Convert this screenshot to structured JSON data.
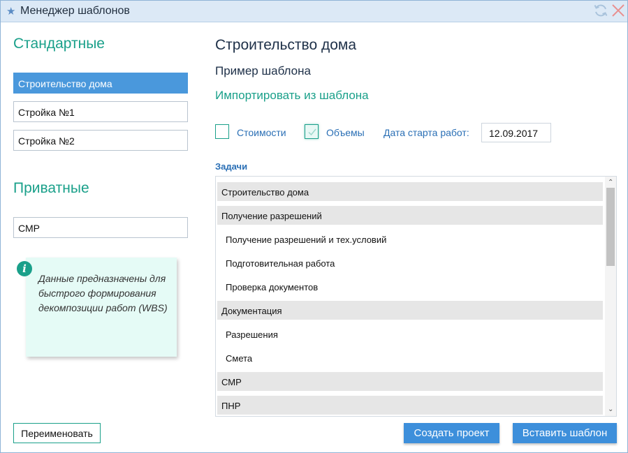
{
  "window": {
    "title": "Менеджер шаблонов"
  },
  "sidebar": {
    "standard_heading": "Стандартные",
    "standard_items": [
      "Строительство дома",
      "Стройка №1",
      "Стройка №2"
    ],
    "private_heading": "Приватные",
    "private_items": [
      "СМР"
    ],
    "info_text": "Данные предназначены для быстрого формирования декомпозиции работ (WBS)",
    "rename_button": "Переименовать"
  },
  "main": {
    "title": "Строительство дома",
    "subtitle": "Пример шаблона",
    "import_link": "Импортировать из шаблона",
    "options": {
      "costs_label": "Стоимости",
      "costs_checked": false,
      "volumes_label": "Объемы",
      "volumes_checked": true,
      "start_date_label": "Дата старта работ:",
      "start_date_value": "12.09.2017"
    },
    "tasks_label": "Задачи",
    "tasks": [
      {
        "label": "Строительство дома",
        "type": "group"
      },
      {
        "label": "Получение разрешений",
        "type": "group"
      },
      {
        "label": "Получение разрешений и тех.условий",
        "type": "child"
      },
      {
        "label": "Подготовительная работа",
        "type": "child"
      },
      {
        "label": "Проверка документов",
        "type": "child"
      },
      {
        "label": "Документация",
        "type": "group"
      },
      {
        "label": "Разрешения",
        "type": "child"
      },
      {
        "label": "Смета",
        "type": "child"
      },
      {
        "label": "СМР",
        "type": "group"
      },
      {
        "label": "ПНР",
        "type": "group"
      }
    ],
    "create_project_button": "Создать проект",
    "insert_template_button": "Вставить шаблон"
  },
  "icons": {
    "star": "star-icon",
    "refresh": "refresh-icon",
    "close": "close-icon",
    "info": "info-icon"
  },
  "colors": {
    "accent_teal": "#1aa08a",
    "selected_blue": "#4a98dc",
    "button_blue": "#3d8fdb",
    "label_blue": "#2a6fb5"
  }
}
